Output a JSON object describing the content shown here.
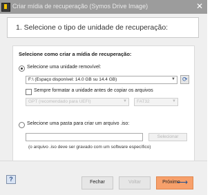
{
  "window": {
    "title": "Criar mídia de recuperação (Symos Drive Image)",
    "close_glyph": "✕"
  },
  "step": {
    "title": "1. Selecione o tipo de unidade de recuperação:"
  },
  "section": {
    "heading": "Selecione como criar a mídia de recuperação:"
  },
  "option_removable": {
    "label": "Selecione uma unidade removível:",
    "selected": true,
    "drive_value": "F:\\ (Espaço disponível: 14.0 GB su 14.4 GB)",
    "format_label": "Sempre formatar a unidade antes de copiar os arquivos",
    "format_checked": false,
    "partition_value": "GPT (recomendado para UEFI)",
    "fs_value": "FAT32"
  },
  "option_iso": {
    "label": "Selecione uma pasta para criar um arquivo .iso:",
    "selected": false,
    "path_value": "",
    "browse_label": "Selecionar",
    "note": "(o arquivo .iso deve ser gravado com um software específico)"
  },
  "footer": {
    "help_label": "?",
    "close_label": "Fechar",
    "back_label": "Voltar",
    "next_label": "Próximo",
    "next_arrow": "⟶"
  },
  "icons": {
    "refresh": "refresh-icon",
    "dropdown": "chevron-down-icon",
    "app": "app-icon"
  },
  "colors": {
    "accent": "#f7a06b",
    "titlebar": "#9c9c9c"
  }
}
